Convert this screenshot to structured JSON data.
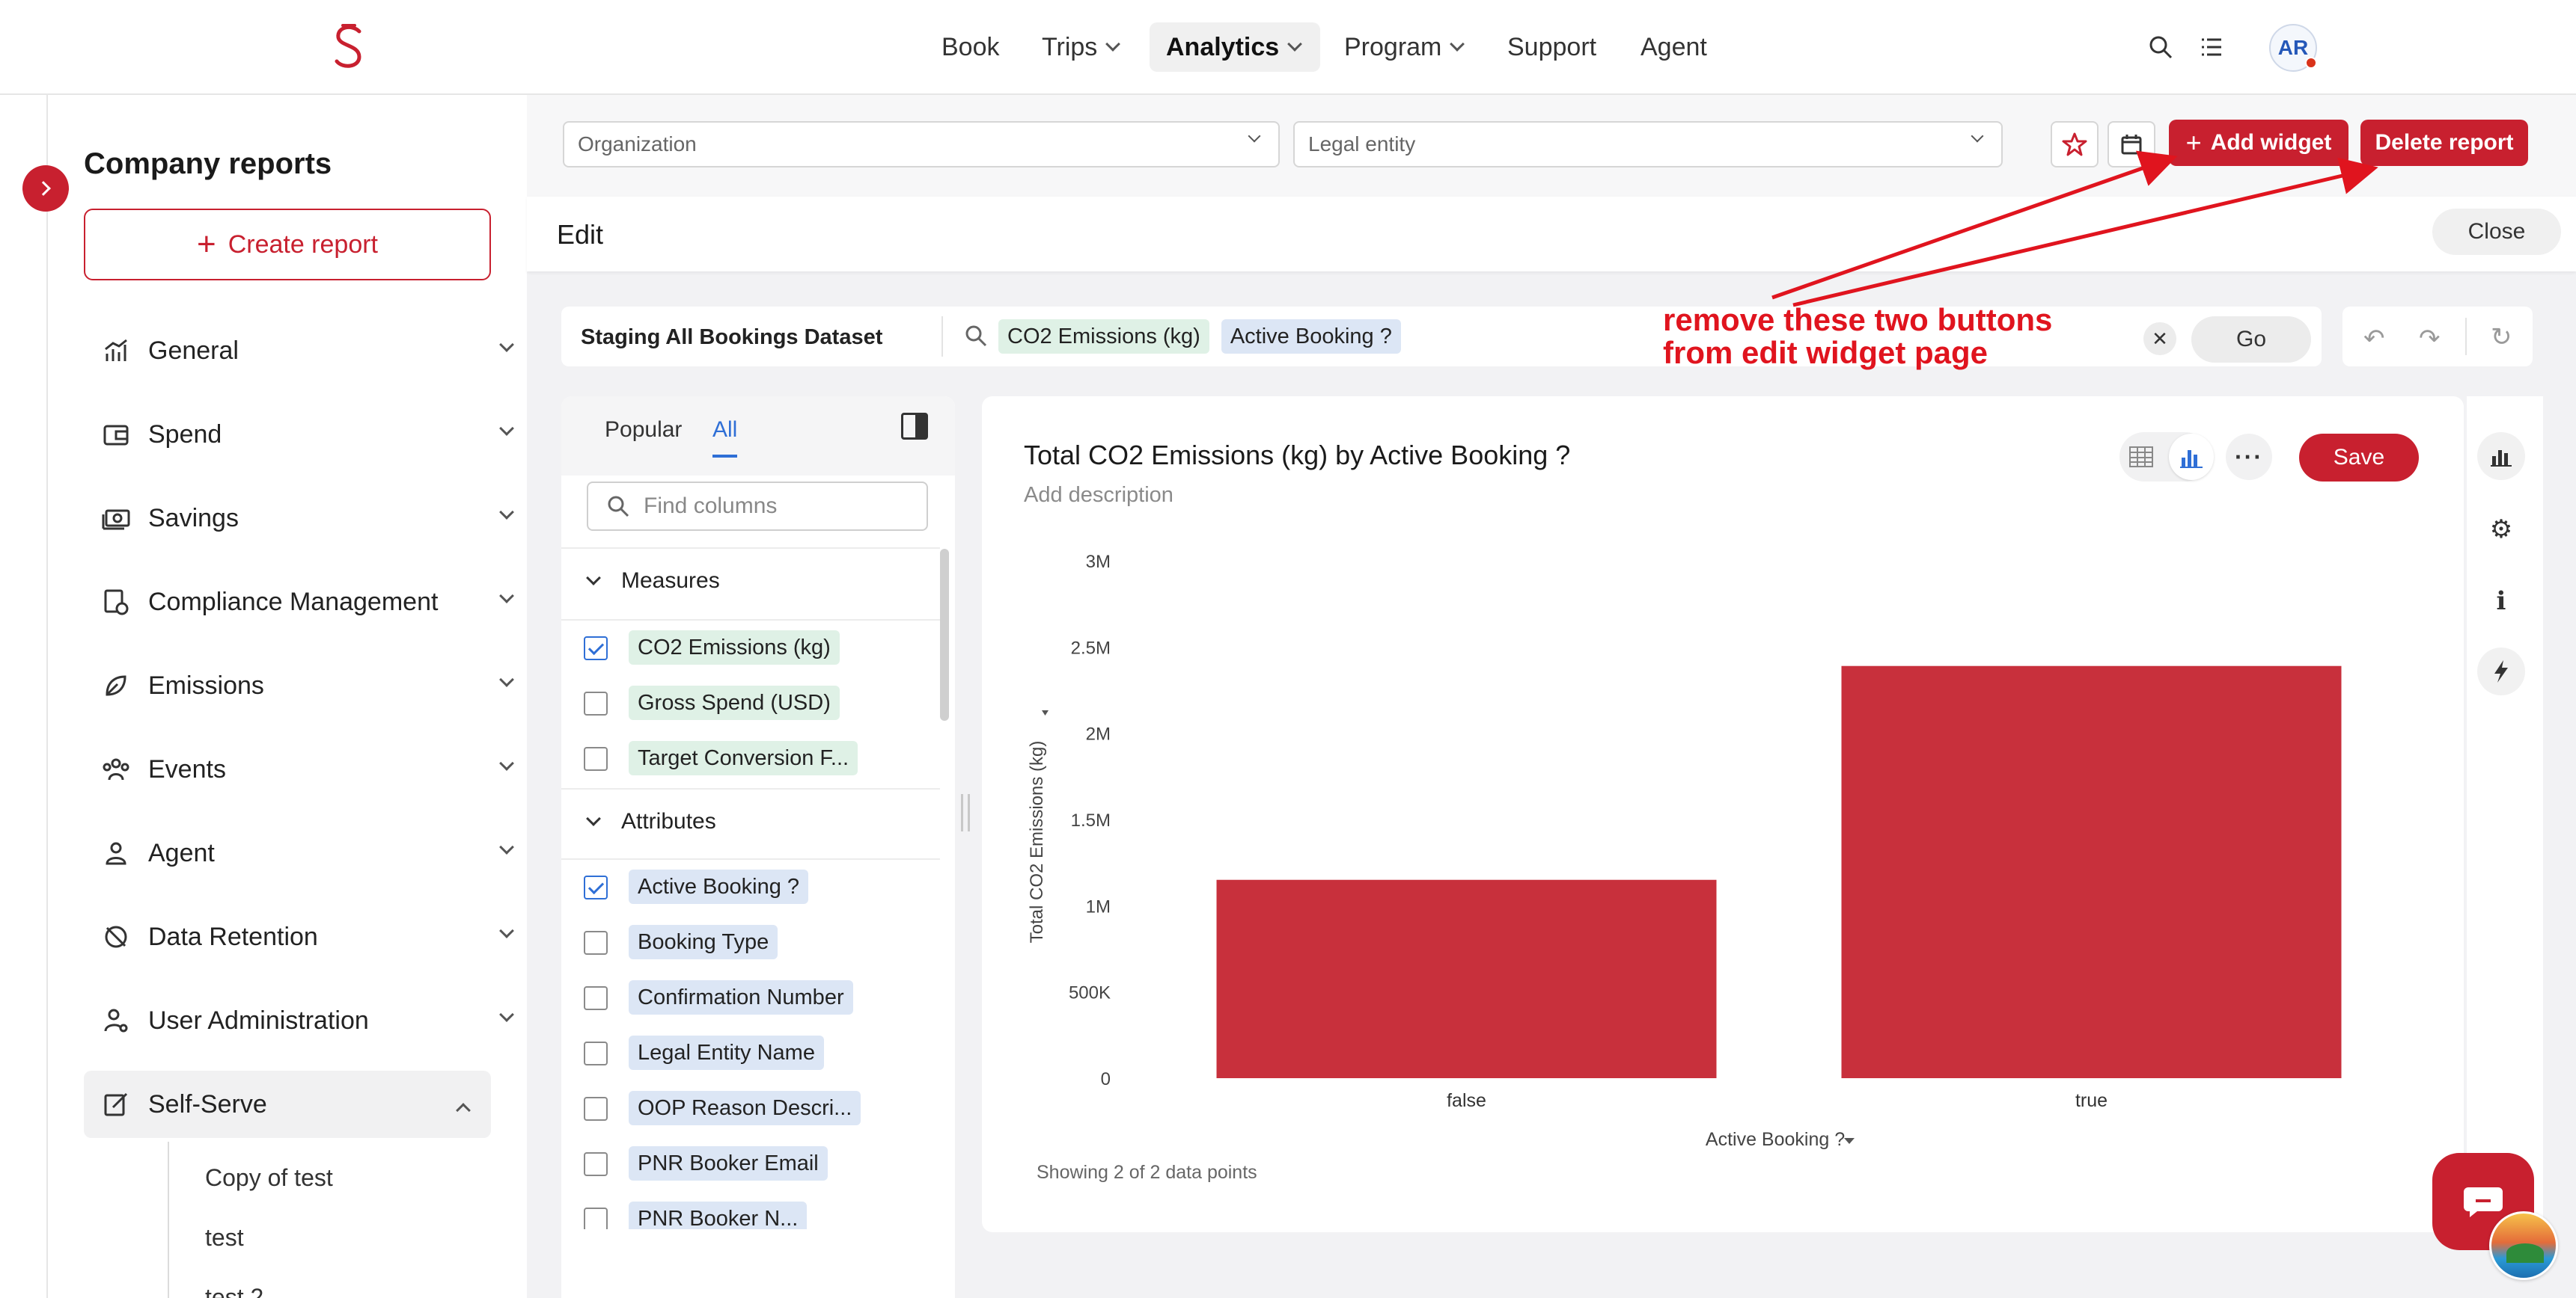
{
  "nav": {
    "book": "Book",
    "trips": "Trips",
    "analytics": "Analytics",
    "program": "Program",
    "support": "Support",
    "agent": "Agent",
    "avatar": "AR"
  },
  "sidebar": {
    "title": "Company reports",
    "create_report": "Create report",
    "items": [
      {
        "label": "General",
        "icon": "bar-chart-icon"
      },
      {
        "label": "Spend",
        "icon": "wallet-icon"
      },
      {
        "label": "Savings",
        "icon": "money-icon"
      },
      {
        "label": "Compliance Management",
        "icon": "compliance-icon"
      },
      {
        "label": "Emissions",
        "icon": "leaf-icon"
      },
      {
        "label": "Events",
        "icon": "people-icon"
      },
      {
        "label": "Agent",
        "icon": "person-icon"
      },
      {
        "label": "Data Retention",
        "icon": "retention-icon"
      },
      {
        "label": "User Administration",
        "icon": "user-admin-icon"
      },
      {
        "label": "Self-Serve",
        "icon": "edit-icon"
      }
    ],
    "sub_items": [
      "Copy of test",
      "test",
      "test 2"
    ]
  },
  "filters": {
    "organization": "Organization",
    "legal_entity": "Legal entity"
  },
  "actions": {
    "add_widget": "Add widget",
    "delete_report": "Delete report",
    "close": "Close",
    "edit_title": "Edit"
  },
  "query": {
    "dataset": "Staging All Bookings Dataset",
    "token1": "CO2 Emissions (kg)",
    "token2": "Active Booking ?",
    "go": "Go"
  },
  "annotation": {
    "line1": "remove these two buttons",
    "line2": "from edit widget page",
    "color": "#e0141e"
  },
  "columns": {
    "tab_popular": "Popular",
    "tab_all": "All",
    "search_placeholder": "Find columns",
    "measures_label": "Measures",
    "measures": [
      {
        "label": "CO2 Emissions (kg)",
        "checked": true
      },
      {
        "label": "Gross Spend (USD)",
        "checked": false
      },
      {
        "label": "Target Conversion F...",
        "checked": false
      }
    ],
    "attributes_label": "Attributes",
    "attributes": [
      {
        "label": "Active Booking ?",
        "checked": true
      },
      {
        "label": "Booking Type",
        "checked": false
      },
      {
        "label": "Confirmation Number",
        "checked": false
      },
      {
        "label": "Legal Entity Name",
        "checked": false
      },
      {
        "label": "OOP Reason Descri...",
        "checked": false
      },
      {
        "label": "PNR Booker Email",
        "checked": false
      },
      {
        "label": "PNR Booker N...",
        "checked": false
      }
    ]
  },
  "widget": {
    "title": "Total CO2 Emissions (kg) by Active Booking ?",
    "description_placeholder": "Add description",
    "save": "Save",
    "footer": "Showing 2 of 2 data points"
  },
  "chart_data": {
    "type": "bar",
    "categories": [
      "false",
      "true"
    ],
    "values": [
      1150000,
      2390000
    ],
    "ylim": [
      0,
      3000000
    ],
    "yticks": [
      "0",
      "500K",
      "1M",
      "1.5M",
      "2M",
      "2.5M",
      "3M"
    ],
    "xlabel": "Active Booking ?",
    "ylabel": "Total CO2 Emissions (kg)",
    "color": "#c8303c"
  },
  "colors": {
    "brand": "#c8202f",
    "accent_blue": "#2f6fd6"
  }
}
